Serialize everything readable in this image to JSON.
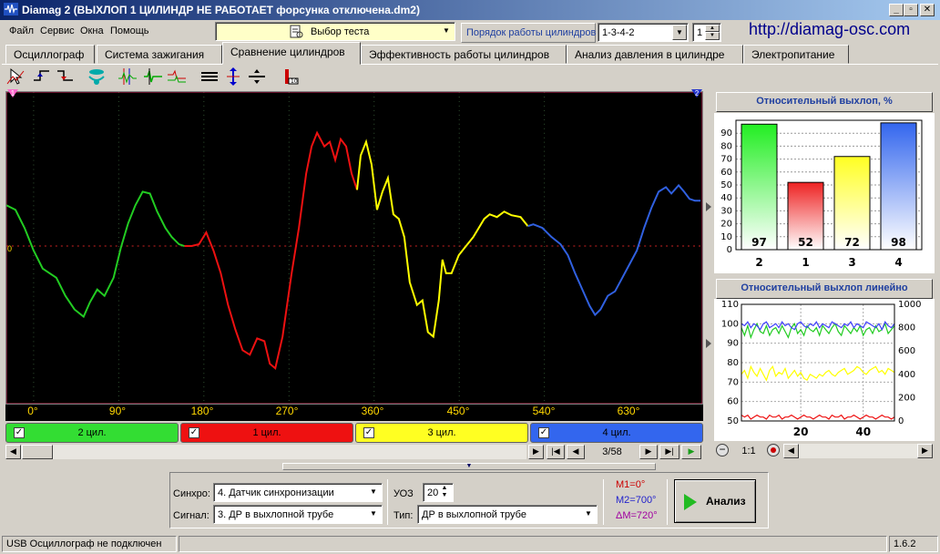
{
  "window": {
    "title": "Diamag 2 (ВЫХЛОП 1 ЦИЛИНДР НЕ РАБОТАЕТ форсунка отключена.dm2)",
    "minimize": "_",
    "maximize": "▫",
    "close": "✕"
  },
  "menu": [
    "Файл",
    "Сервис",
    "Окна",
    "Помощь"
  ],
  "test_select": {
    "value": "Выбор теста"
  },
  "cylinder_order": {
    "label": "Порядок работы цилиндров",
    "value": "1-3-4-2",
    "spin_value": "1"
  },
  "url": "http://diamag-osc.com",
  "tabs": [
    {
      "label": "Осциллограф",
      "active": false
    },
    {
      "label": "Система зажигания",
      "active": false
    },
    {
      "label": "Сравнение цилиндров",
      "active": true
    },
    {
      "label": "Эффективность работы цилиндров",
      "active": false
    },
    {
      "label": "Анализ давления в цилиндре",
      "active": false
    },
    {
      "label": "Электропитание",
      "active": false
    }
  ],
  "scope": {
    "zero_label": "0",
    "marker_left": "1",
    "marker_right": "2",
    "x_ticks": [
      "0°",
      "90°",
      "180°",
      "270°",
      "360°",
      "450°",
      "540°",
      "630°"
    ]
  },
  "cylinders": [
    {
      "label": "2 цил.",
      "color": "#22cc22",
      "checked": true
    },
    {
      "label": "1 цил.",
      "color": "#ee1111",
      "checked": true
    },
    {
      "label": "3 цил.",
      "color": "#ffff00",
      "checked": true
    },
    {
      "label": "4 цил.",
      "color": "#3060e0",
      "checked": true
    }
  ],
  "nav": {
    "page": "3/58"
  },
  "bar_chart_title": "Относительный выхлоп, %",
  "line_chart_title": "Относительный выхлоп линейно",
  "line_zoom_label": "1:1",
  "chart_data": [
    {
      "type": "bar",
      "title": "Относительный выхлоп, %",
      "categories": [
        "2",
        "1",
        "3",
        "4"
      ],
      "values": [
        97,
        52,
        72,
        98
      ],
      "colors": [
        "#22ee22",
        "#ee2222",
        "#ffff22",
        "#3366ee"
      ],
      "ylim": [
        0,
        100
      ],
      "y_ticks": [
        0,
        10,
        20,
        30,
        40,
        50,
        60,
        70,
        80,
        90
      ],
      "grid": true
    },
    {
      "type": "line",
      "title": "Относительный выхлоп линейно",
      "x_ticks": [
        20,
        40
      ],
      "left_ylim": [
        50,
        110
      ],
      "left_ticks": [
        50,
        60,
        70,
        80,
        90,
        100,
        110
      ],
      "right_ylim": [
        0,
        1000
      ],
      "right_ticks": [
        0,
        200,
        400,
        600,
        800,
        1000
      ],
      "grid": true,
      "series": [
        {
          "color": "#22cc22",
          "values": [
            98,
            94,
            99,
            93,
            97,
            100,
            96,
            95,
            99,
            94,
            97,
            98,
            95,
            99,
            96,
            93,
            98,
            100,
            95,
            97,
            94,
            99,
            97,
            96,
            98,
            94,
            99,
            97,
            95,
            98,
            100,
            96,
            94,
            99,
            97,
            95,
            98,
            96,
            99,
            94,
            97,
            98,
            95,
            99,
            96,
            97,
            100,
            95,
            97,
            99
          ]
        },
        {
          "color": "#4040ff",
          "values": [
            100,
            99,
            101,
            98,
            100,
            99,
            97,
            100,
            101,
            98,
            99,
            100,
            98,
            101,
            99,
            100,
            98,
            97,
            100,
            101,
            99,
            98,
            100,
            99,
            101,
            98,
            100,
            99,
            98,
            101,
            100,
            99,
            98,
            100,
            99,
            101,
            98,
            100,
            99,
            98,
            101,
            100,
            99,
            98,
            100,
            97,
            101,
            99,
            98,
            100
          ]
        },
        {
          "color": "#ffff00",
          "values": [
            74,
            76,
            72,
            78,
            75,
            73,
            77,
            74,
            71,
            76,
            78,
            73,
            75,
            74,
            77,
            72,
            74,
            76,
            73,
            75,
            72,
            71,
            74,
            73,
            72,
            74,
            73,
            75,
            76,
            74,
            73,
            75,
            76,
            77,
            74,
            75,
            76,
            78,
            77,
            75,
            74,
            76,
            77,
            78,
            75,
            76,
            74,
            77,
            76,
            75
          ]
        },
        {
          "color": "#ee1111",
          "values": [
            53,
            52,
            53,
            51,
            52,
            53,
            52,
            52,
            51,
            53,
            52,
            52,
            53,
            51,
            52,
            52,
            53,
            52,
            51,
            52,
            53,
            52,
            52,
            51,
            52,
            53,
            52,
            52,
            51,
            53,
            52,
            52,
            53,
            51,
            52,
            52,
            53,
            52,
            51,
            52,
            53,
            52,
            52,
            51,
            52,
            53,
            52,
            52,
            51,
            52
          ]
        }
      ]
    }
  ],
  "sync": {
    "label": "Синхро:",
    "value": "4.  Датчик синхронизации"
  },
  "signal": {
    "label": "Сигнал:",
    "value": "3.  ДР в выхлопной трубе"
  },
  "uoz": {
    "label": "УОЗ",
    "value": "20"
  },
  "type": {
    "label": "Тип:",
    "value": "ДР в выхлопной трубе"
  },
  "markers": {
    "m1": "M1=0°",
    "m2": "M2=700°",
    "dm": "ΔM=720°"
  },
  "analyze_label": "Анализ",
  "status": {
    "connection": "USB Осциллограф не подключен",
    "version": "1.6.2"
  }
}
